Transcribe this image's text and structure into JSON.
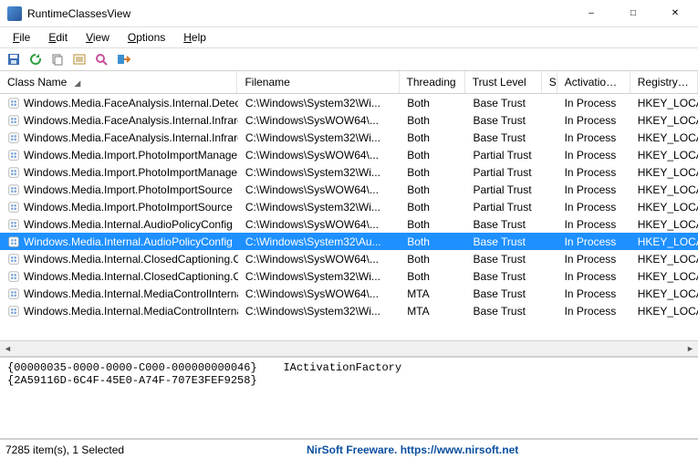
{
  "window": {
    "title": "RuntimeClassesView"
  },
  "menu": {
    "file": "File",
    "edit": "Edit",
    "view": "View",
    "options": "Options",
    "help": "Help"
  },
  "columns": [
    "Class Name",
    "Filename",
    "Threading",
    "Trust Level",
    "S",
    "Activation ...",
    "Registry Key"
  ],
  "rows": [
    {
      "class": "Windows.Media.FaceAnalysis.Internal.Detect...",
      "file": "C:\\Windows\\System32\\Wi...",
      "thread": "Both",
      "trust": "Base Trust",
      "act": "In Process",
      "reg": "HKEY_LOCA",
      "sel": false
    },
    {
      "class": "Windows.Media.FaceAnalysis.Internal.Infrare...",
      "file": "C:\\Windows\\SysWOW64\\...",
      "thread": "Both",
      "trust": "Base Trust",
      "act": "In Process",
      "reg": "HKEY_LOCA",
      "sel": false
    },
    {
      "class": "Windows.Media.FaceAnalysis.Internal.Infrare...",
      "file": "C:\\Windows\\System32\\Wi...",
      "thread": "Both",
      "trust": "Base Trust",
      "act": "In Process",
      "reg": "HKEY_LOCA",
      "sel": false
    },
    {
      "class": "Windows.Media.Import.PhotoImportManager",
      "file": "C:\\Windows\\SysWOW64\\...",
      "thread": "Both",
      "trust": "Partial Trust",
      "act": "In Process",
      "reg": "HKEY_LOCA",
      "sel": false
    },
    {
      "class": "Windows.Media.Import.PhotoImportManager",
      "file": "C:\\Windows\\System32\\Wi...",
      "thread": "Both",
      "trust": "Partial Trust",
      "act": "In Process",
      "reg": "HKEY_LOCA",
      "sel": false
    },
    {
      "class": "Windows.Media.Import.PhotoImportSource",
      "file": "C:\\Windows\\SysWOW64\\...",
      "thread": "Both",
      "trust": "Partial Trust",
      "act": "In Process",
      "reg": "HKEY_LOCA",
      "sel": false
    },
    {
      "class": "Windows.Media.Import.PhotoImportSource",
      "file": "C:\\Windows\\System32\\Wi...",
      "thread": "Both",
      "trust": "Partial Trust",
      "act": "In Process",
      "reg": "HKEY_LOCA",
      "sel": false
    },
    {
      "class": "Windows.Media.Internal.AudioPolicyConfig",
      "file": "C:\\Windows\\SysWOW64\\...",
      "thread": "Both",
      "trust": "Base Trust",
      "act": "In Process",
      "reg": "HKEY_LOCA",
      "sel": false
    },
    {
      "class": "Windows.Media.Internal.AudioPolicyConfig",
      "file": "C:\\Windows\\System32\\Au...",
      "thread": "Both",
      "trust": "Base Trust",
      "act": "In Process",
      "reg": "HKEY_LOCA",
      "sel": true
    },
    {
      "class": "Windows.Media.Internal.ClosedCaptioning.C...",
      "file": "C:\\Windows\\SysWOW64\\...",
      "thread": "Both",
      "trust": "Base Trust",
      "act": "In Process",
      "reg": "HKEY_LOCA",
      "sel": false
    },
    {
      "class": "Windows.Media.Internal.ClosedCaptioning.C...",
      "file": "C:\\Windows\\System32\\Wi...",
      "thread": "Both",
      "trust": "Base Trust",
      "act": "In Process",
      "reg": "HKEY_LOCA",
      "sel": false
    },
    {
      "class": "Windows.Media.Internal.MediaControlInternal",
      "file": "C:\\Windows\\SysWOW64\\...",
      "thread": "MTA",
      "trust": "Base Trust",
      "act": "In Process",
      "reg": "HKEY_LOCA",
      "sel": false
    },
    {
      "class": "Windows.Media.Internal.MediaControlInternal",
      "file": "C:\\Windows\\System32\\Wi...",
      "thread": "MTA",
      "trust": "Base Trust",
      "act": "In Process",
      "reg": "HKEY_LOCA",
      "sel": false
    }
  ],
  "detail": "{00000035-0000-0000-C000-000000000046}    IActivationFactory\n{2A59116D-6C4F-45E0-A74F-707E3FEF9258}",
  "status": {
    "left": "7285 item(s), 1 Selected",
    "right": "NirSoft Freeware. https://www.nirsoft.net"
  }
}
